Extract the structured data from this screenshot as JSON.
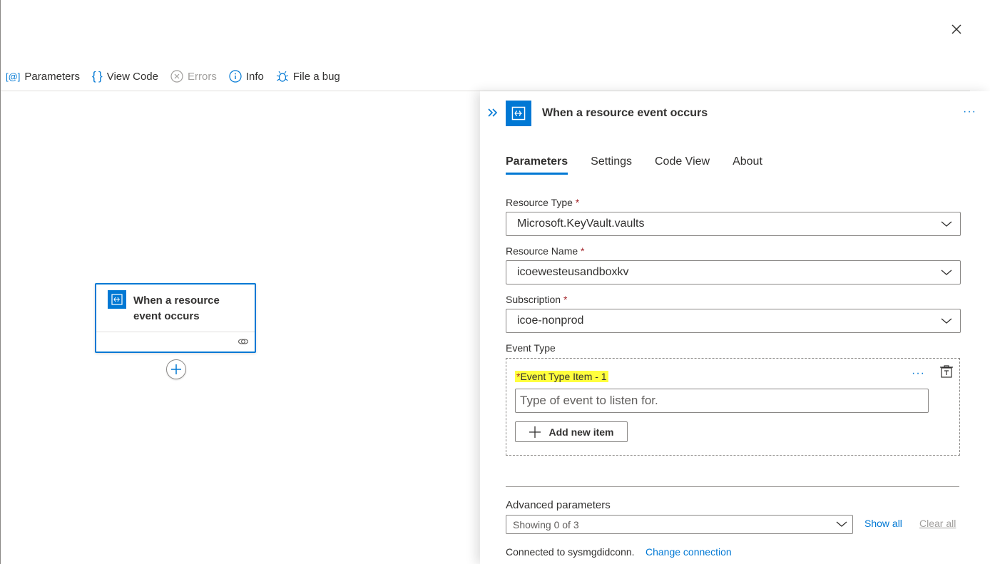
{
  "toolbar": {
    "parameters": "Parameters",
    "view_code": "View Code",
    "errors": "Errors",
    "info": "Info",
    "file_bug": "File a bug"
  },
  "canvas": {
    "node_title": "When a resource event occurs"
  },
  "panel": {
    "title": "When a resource event occurs",
    "tabs": [
      {
        "label": "Parameters",
        "active": true
      },
      {
        "label": "Settings",
        "active": false
      },
      {
        "label": "Code View",
        "active": false
      },
      {
        "label": "About",
        "active": false
      }
    ],
    "fields": {
      "resource_type": {
        "label": "Resource Type",
        "required": "*",
        "value": "Microsoft.KeyVault.vaults"
      },
      "resource_name": {
        "label": "Resource Name",
        "required": "*",
        "value": "icoewesteusandboxkv"
      },
      "subscription": {
        "label": "Subscription",
        "required": "*",
        "value": "icoe-nonprod"
      }
    },
    "event_type": {
      "label": "Event Type",
      "item_label": "Event Type Item - 1",
      "item_required": "*",
      "placeholder": "Type of event to listen for.",
      "add_button": "Add new item"
    },
    "advanced": {
      "label": "Advanced parameters",
      "value": "Showing 0 of 3",
      "show_all": "Show all",
      "clear_all": "Clear all"
    },
    "connection": {
      "text": "Connected to sysmgdidconn.",
      "change_link": "Change connection"
    }
  },
  "colors": {
    "accent": "#0078d4",
    "highlight": "#ffff3e",
    "required": "#a4262c",
    "disabled": "#a19f9d"
  }
}
